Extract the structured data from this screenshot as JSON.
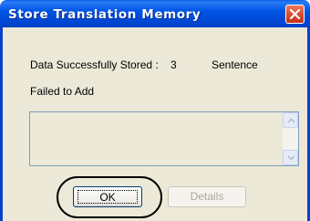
{
  "window": {
    "title": "Store Translation Memory"
  },
  "status": {
    "stored_label": "Data Successfully Stored :",
    "stored_count": "3",
    "stored_unit": "Sentence",
    "failed_label": "Failed to Add"
  },
  "buttons": {
    "ok": "OK",
    "details": "Details"
  },
  "icons": {
    "close": "close-icon",
    "scroll_up": "scroll-up-arrow-icon",
    "scroll_down": "scroll-down-arrow-icon"
  },
  "colors": {
    "titlebar": "#0055e5",
    "close": "#d6452a",
    "dialog_bg": "#ece9d8"
  }
}
